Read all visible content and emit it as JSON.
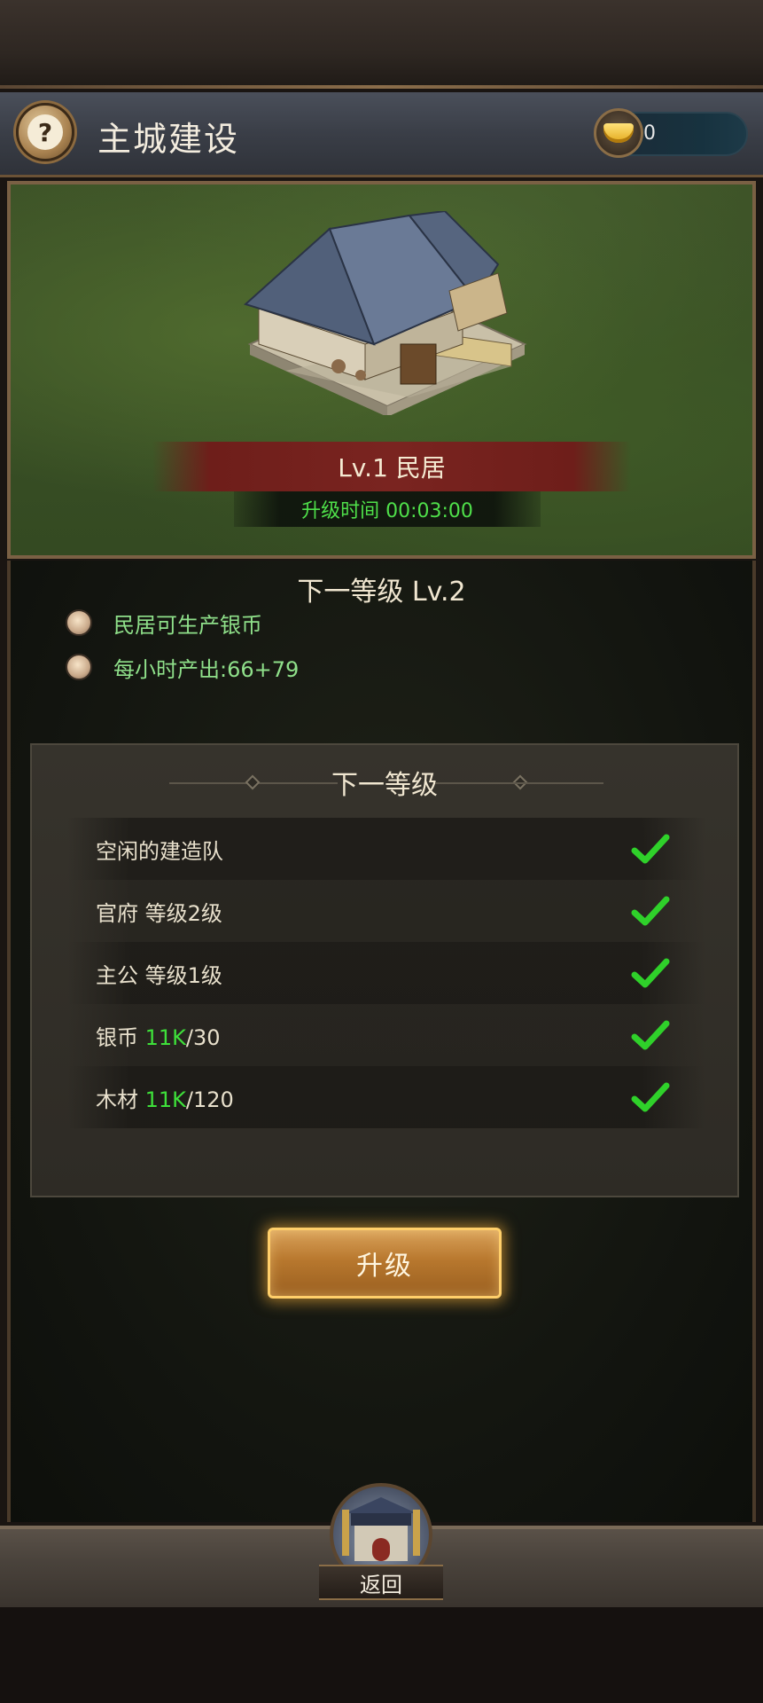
{
  "header": {
    "title": "主城建设",
    "help_icon": "question-mark",
    "currency": {
      "icon": "gold-ingot",
      "value": "0"
    }
  },
  "building": {
    "level_name": "Lv.1 民居",
    "upgrade_time": "升级时间 00:03:00"
  },
  "next_level": {
    "title": "下一等级 Lv.2",
    "features": [
      "民居可生产银币",
      "每小时产出:66+79"
    ]
  },
  "requirements": {
    "title": "下一等级",
    "items": [
      {
        "label": "空闲的建造队",
        "met": true
      },
      {
        "label": "官府 等级2级",
        "met": true
      },
      {
        "label": "主公 等级1级",
        "met": true
      },
      {
        "label_prefix": "银币 ",
        "label_have": "11K",
        "label_need": "/30",
        "met": true
      },
      {
        "label_prefix": "木材 ",
        "label_have": "11K",
        "label_need": "/120",
        "met": true
      }
    ]
  },
  "actions": {
    "upgrade_label": "升级",
    "back_label": "返回"
  },
  "colors": {
    "status_green": "#3ee03a",
    "button_gold": "#ffcf6a"
  }
}
